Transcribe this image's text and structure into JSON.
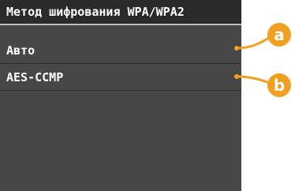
{
  "title": "Метод шифрования WPA/WPA2",
  "options": [
    {
      "label": "Авто",
      "callout": "a"
    },
    {
      "label": "AES-CCMP",
      "callout": "b"
    }
  ],
  "colors": {
    "screen_bg": "#474747",
    "title_bg": "#2a2a2a",
    "text": "#ffffff",
    "callout": "#f0a020"
  }
}
